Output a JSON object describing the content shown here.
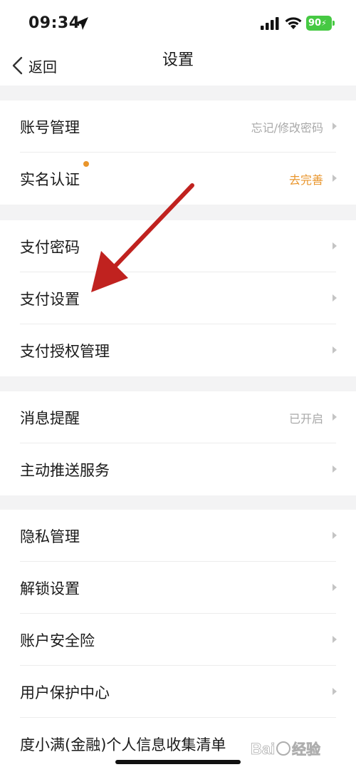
{
  "status": {
    "time": "09:34",
    "battery": "90"
  },
  "nav": {
    "back_label": "返回",
    "title": "设置"
  },
  "groups": [
    {
      "rows": [
        {
          "label": "账号管理",
          "value": "忘记/修改密码"
        },
        {
          "label": "实名认证",
          "value": "去完善"
        }
      ]
    },
    {
      "rows": [
        {
          "label": "支付密码"
        },
        {
          "label": "支付设置"
        },
        {
          "label": "支付授权管理"
        }
      ]
    },
    {
      "rows": [
        {
          "label": "消息提醒",
          "value": "已开启"
        },
        {
          "label": "主动推送服务"
        }
      ]
    },
    {
      "rows": [
        {
          "label": "隐私管理"
        },
        {
          "label": "解锁设置"
        },
        {
          "label": "账户安全险"
        },
        {
          "label": "用户保护中心"
        },
        {
          "label": "度小满(金融)个人信息收集清单"
        }
      ]
    }
  ],
  "watermark": {
    "text": "Baidu 经验"
  },
  "colors": {
    "accent_orange": "#e9952b",
    "annotation_red": "#c0221f",
    "battery_green": "#46c943"
  }
}
